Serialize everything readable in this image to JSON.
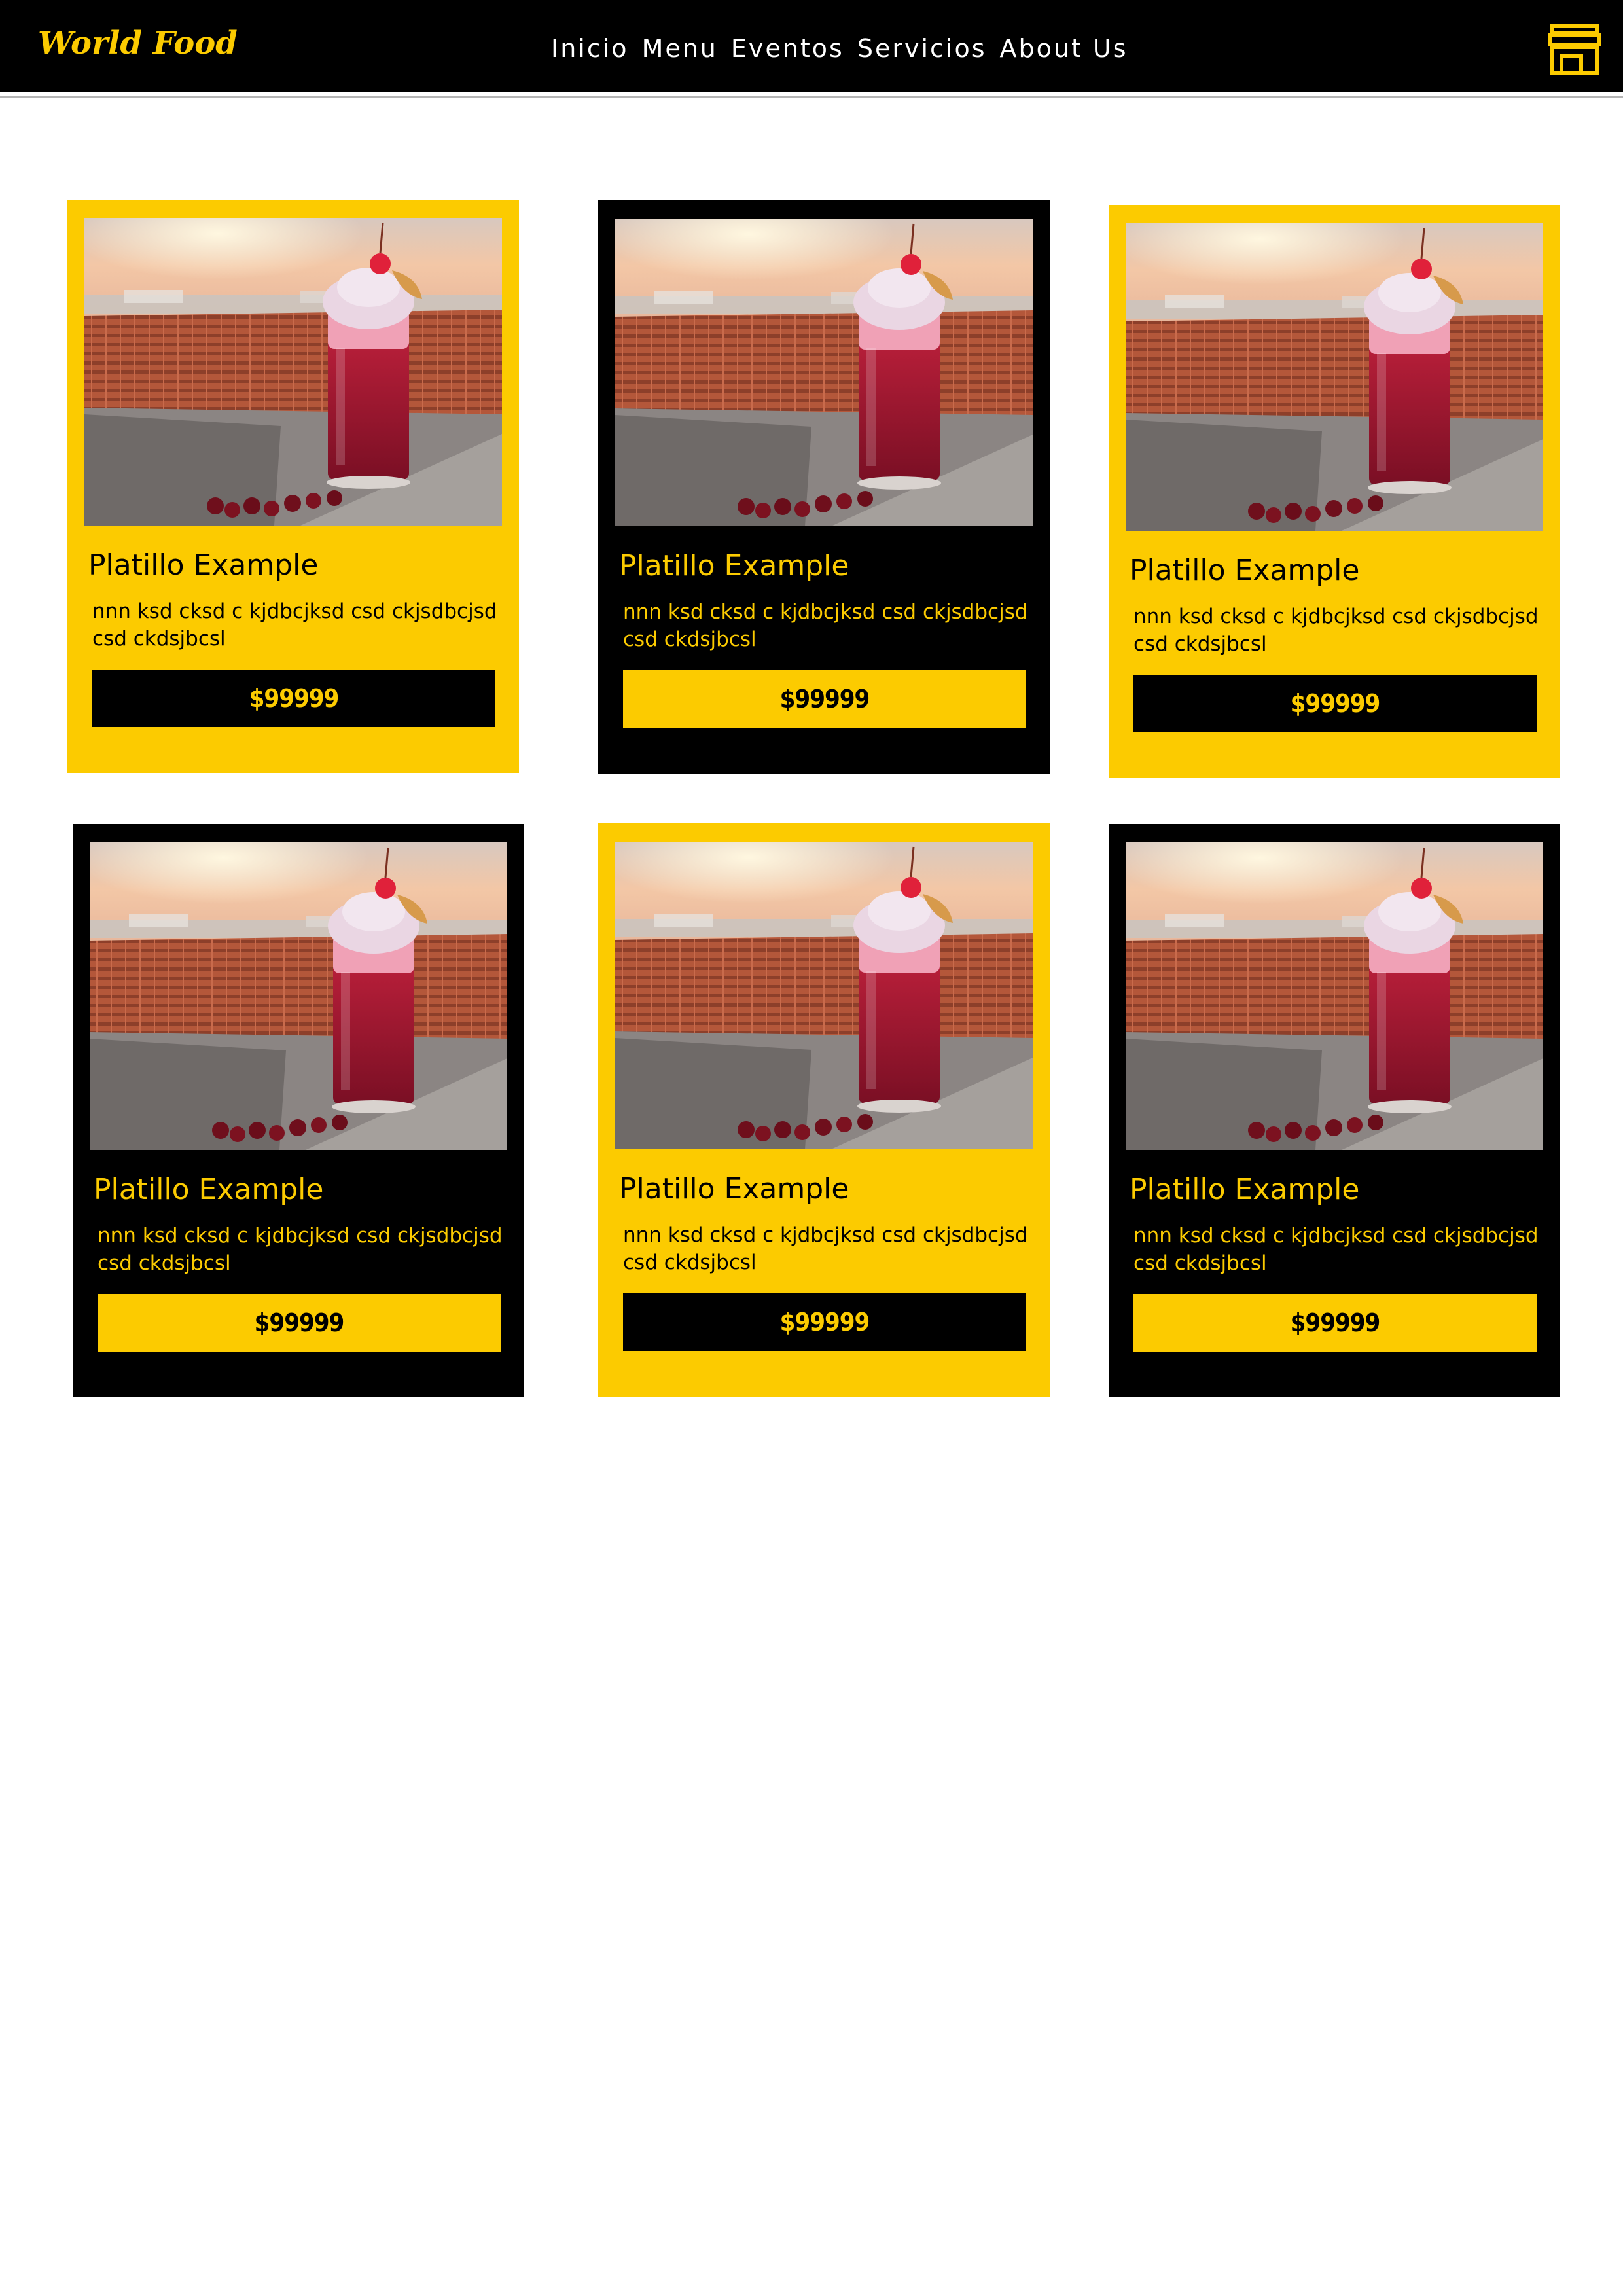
{
  "header": {
    "brand": "World Food",
    "nav": [
      "Inicio",
      "Menu",
      "Eventos",
      "Servicios",
      "About Us"
    ],
    "cart_icon": "storefront-icon"
  },
  "colors": {
    "accent": "#fccb00",
    "dark": "#000000",
    "page": "#ffffff"
  },
  "cards": [
    {
      "theme": "gold",
      "title": "Platillo Example",
      "description": "nnn ksd cksd c kjdbcjksd csd ckjsdbcjsd csd ckdsjbcsl",
      "price": "$99999",
      "image": "cherry-drink-photo"
    },
    {
      "theme": "dark",
      "title": "Platillo Example",
      "description": "nnn ksd cksd c kjdbcjksd csd ckjsdbcjsd csd ckdsjbcsl",
      "price": "$99999",
      "image": "cherry-drink-photo"
    },
    {
      "theme": "gold",
      "title": "Platillo Example",
      "description": "nnn ksd cksd c kjdbcjksd csd ckjsdbcjsd csd ckdsjbcsl",
      "price": "$99999",
      "image": "cherry-drink-photo"
    },
    {
      "theme": "dark",
      "title": "Platillo Example",
      "description": "nnn ksd cksd c kjdbcjksd csd ckjsdbcjsd csd ckdsjbcsl",
      "price": "$99999",
      "image": "cherry-drink-photo"
    },
    {
      "theme": "gold",
      "title": "Platillo Example",
      "description": "nnn ksd cksd c kjdbcjksd csd ckjsdbcjsd csd ckdsjbcsl",
      "price": "$99999",
      "image": "cherry-drink-photo"
    },
    {
      "theme": "dark",
      "title": "Platillo Example",
      "description": "nnn ksd cksd c kjdbcjksd csd ckjsdbcjsd csd ckdsjbcsl",
      "price": "$99999",
      "image": "cherry-drink-photo"
    }
  ]
}
